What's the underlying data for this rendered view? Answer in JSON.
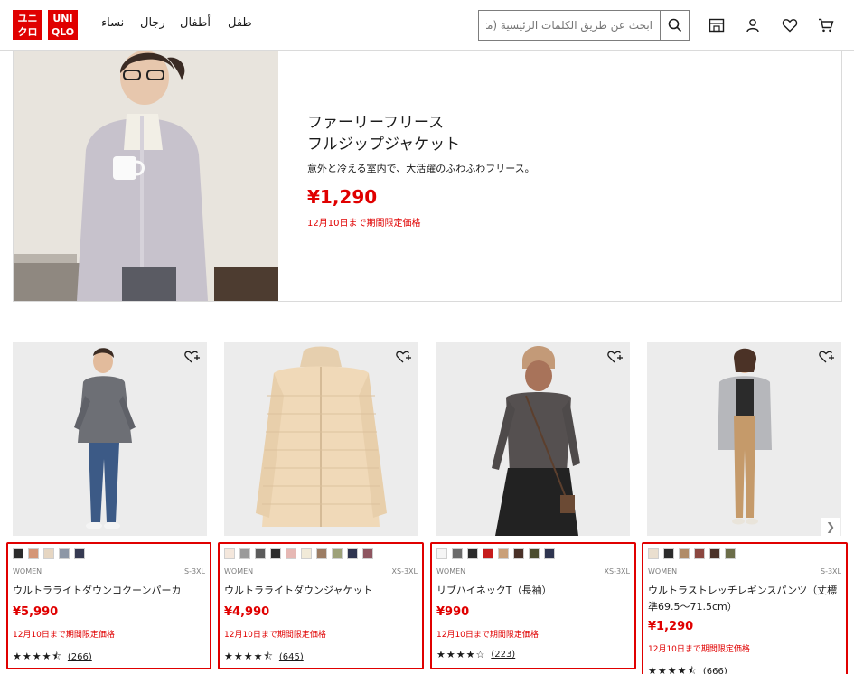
{
  "brand": {
    "logo_left": "ユニ\nクロ",
    "logo_right": "UNI\nQLO",
    "accent": "#e00000"
  },
  "nav": {
    "women": "نساء",
    "men": "رجال",
    "kids": "أطفال",
    "baby": "طفل"
  },
  "search": {
    "placeholder": "ابحث عن طريق الكلمات الرئيسية (مثال"
  },
  "header_icons": [
    "search-icon",
    "store-icon",
    "user-icon",
    "heart-icon",
    "cart-icon"
  ],
  "hero": {
    "title_line1": "ファーリーフリース",
    "title_line2": "フルジップジャケット",
    "description": "意外と冷える室内で、大活躍のふわふわフリース。",
    "price": "¥1,290",
    "note": "12月10日まで期間限定価格"
  },
  "products": [
    {
      "gender": "WOMEN",
      "size": "S-3XL",
      "name": "ウルトラライトダウンコクーンパーカ",
      "price": "¥5,990",
      "note": "12月10日まで期間限定価格",
      "stars": "★★★★⯪",
      "rating_count": "(266)",
      "swatches": [
        "#2b2b2b",
        "#d49677",
        "#e6d6c2",
        "#8d97a6",
        "#363a52"
      ]
    },
    {
      "gender": "WOMEN",
      "size": "XS-3XL",
      "name": "ウルトラライトダウンジャケット",
      "price": "¥4,990",
      "note": "12月10日まで期間限定価格",
      "stars": "★★★★⯪",
      "rating_count": "(645)",
      "swatches": [
        "#f4e7dc",
        "#9a9a9a",
        "#5c5c5c",
        "#2b2b2b",
        "#e6b8b4",
        "#f1ead8",
        "#9c7d64",
        "#9da179",
        "#2f3550",
        "#8e5560"
      ]
    },
    {
      "gender": "WOMEN",
      "size": "XS-3XL",
      "name": "リブハイネックT（長袖）",
      "price": "¥990",
      "note": "12月10日まで期間限定価格",
      "stars": "★★★★☆",
      "rating_count": "(223)",
      "swatches": [
        "#f5f5f5",
        "#6b6b6b",
        "#2b2b2b",
        "#c61c1c",
        "#c9a079",
        "#4a3128",
        "#4b4c2f",
        "#2f3550"
      ]
    },
    {
      "gender": "WOMEN",
      "size": "S-3XL",
      "name": "ウルトラストレッチレギンスパンツ（丈標準69.5～71.5cm）",
      "price": "¥1,290",
      "note": "12月10日まで期間限定価格",
      "stars": "★★★★⯪",
      "rating_count": "(666)",
      "swatches": [
        "#eadfcf",
        "#2b2b2b",
        "#b08c68",
        "#8b4740",
        "#4a3128",
        "#6c6e4a"
      ]
    }
  ]
}
